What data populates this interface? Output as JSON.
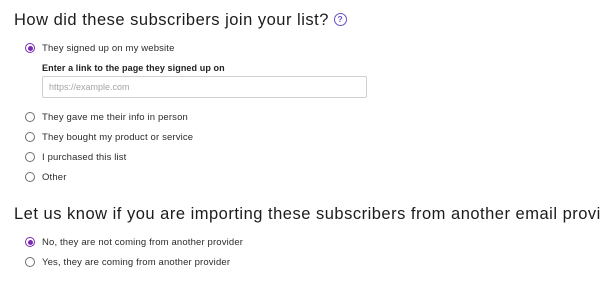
{
  "question1": {
    "title": "How did these subscribers join your list?",
    "help_icon": "question-circle-icon",
    "options": [
      {
        "label": "They signed up on my website",
        "checked": true
      },
      {
        "label": "They gave me their info in person",
        "checked": false
      },
      {
        "label": "They bought my product or service",
        "checked": false
      },
      {
        "label": "I purchased this list",
        "checked": false
      },
      {
        "label": "Other",
        "checked": false
      }
    ],
    "link_field": {
      "label": "Enter a link to the page they signed up on",
      "placeholder": "https://example.com",
      "value": ""
    }
  },
  "question2": {
    "title": "Let us know if you are importing these subscribers from another email provider",
    "options": [
      {
        "label": "No, they are not coming from another provider",
        "checked": true
      },
      {
        "label": "Yes, they are coming from another provider",
        "checked": false
      }
    ]
  },
  "colors": {
    "accent": "#7b2ab8",
    "help_icon": "#6a4fc9",
    "text": "#1c1c1c"
  }
}
